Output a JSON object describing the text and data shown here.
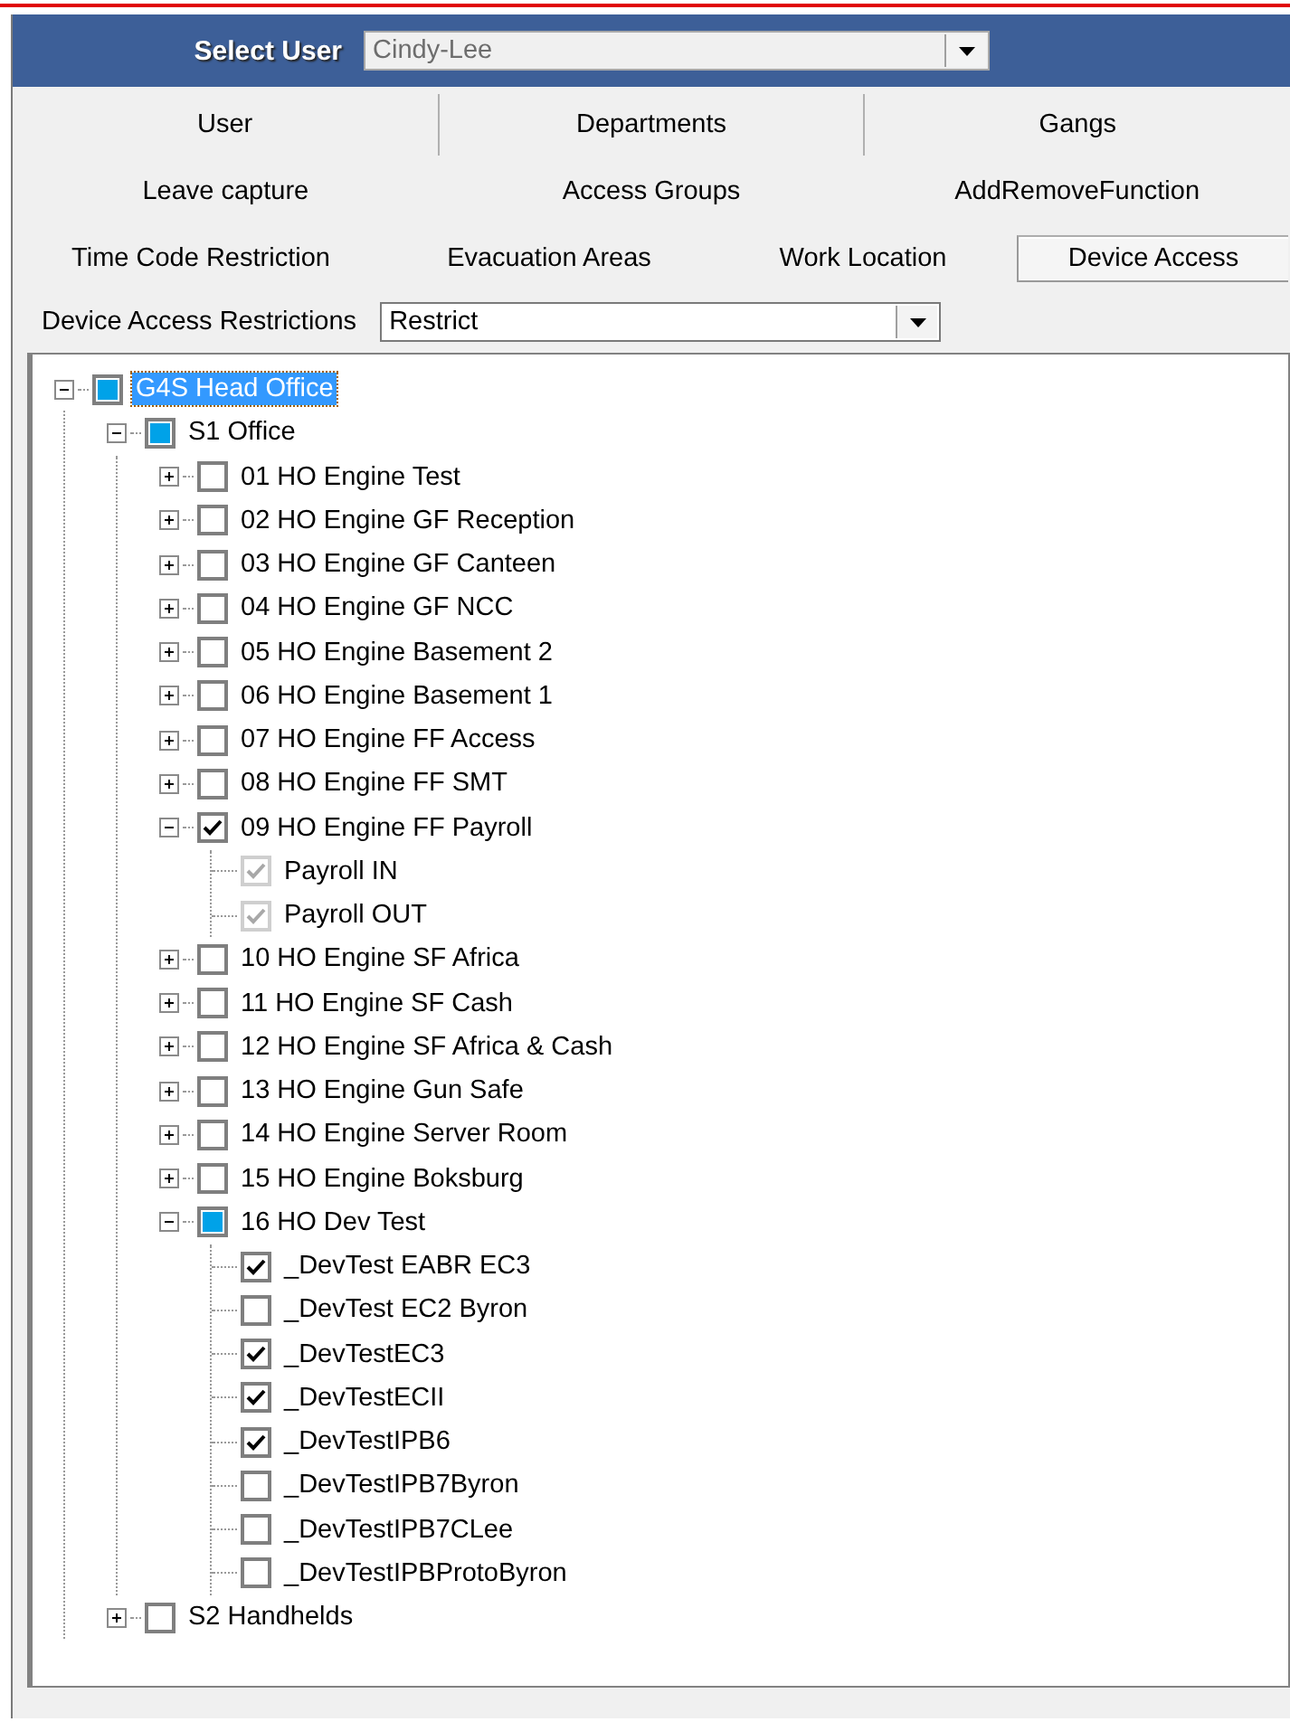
{
  "header": {
    "label": "Select User",
    "user_select": {
      "value": "Cindy-Lee",
      "disabled": true
    }
  },
  "tab_rows": [
    [
      {
        "label": "User",
        "selected": false
      },
      {
        "label": "Departments",
        "selected": false
      },
      {
        "label": "Gangs",
        "selected": false
      }
    ],
    [
      {
        "label": "Leave capture",
        "selected": false
      },
      {
        "label": "Access Groups",
        "selected": false
      },
      {
        "label": "AddRemoveFunction",
        "selected": false
      }
    ],
    [
      {
        "label": "Time Code Restriction",
        "selected": false
      },
      {
        "label": "Evacuation Areas",
        "selected": false
      },
      {
        "label": "Work Location",
        "selected": false
      },
      {
        "label": "Device Access",
        "selected": true
      }
    ]
  ],
  "restriction": {
    "label": "Device Access Restrictions",
    "select": {
      "value": "Restrict",
      "disabled": false
    }
  },
  "tree": [
    {
      "label": "G4S Head Office",
      "kind": "branch",
      "expanded": true,
      "checked": false,
      "partial": true,
      "disabled": false,
      "selected": true,
      "children": [
        {
          "label": "S1 Office",
          "kind": "branch",
          "expanded": true,
          "checked": false,
          "partial": true,
          "disabled": false,
          "selected": false,
          "children": [
            {
              "label": "01 HO Engine Test",
              "kind": "branch",
              "expanded": false,
              "checked": false,
              "partial": false,
              "disabled": false,
              "selected": false
            },
            {
              "label": "02 HO Engine GF Reception",
              "kind": "branch",
              "expanded": false,
              "checked": false,
              "partial": false,
              "disabled": false,
              "selected": false
            },
            {
              "label": "03 HO Engine GF Canteen",
              "kind": "branch",
              "expanded": false,
              "checked": false,
              "partial": false,
              "disabled": false,
              "selected": false
            },
            {
              "label": "04 HO Engine GF NCC",
              "kind": "branch",
              "expanded": false,
              "checked": false,
              "partial": false,
              "disabled": false,
              "selected": false
            },
            {
              "label": "05 HO Engine Basement 2",
              "kind": "branch",
              "expanded": false,
              "checked": false,
              "partial": false,
              "disabled": false,
              "selected": false
            },
            {
              "label": "06 HO Engine Basement 1",
              "kind": "branch",
              "expanded": false,
              "checked": false,
              "partial": false,
              "disabled": false,
              "selected": false
            },
            {
              "label": "07 HO Engine FF Access",
              "kind": "branch",
              "expanded": false,
              "checked": false,
              "partial": false,
              "disabled": false,
              "selected": false
            },
            {
              "label": "08 HO Engine FF SMT",
              "kind": "branch",
              "expanded": false,
              "checked": false,
              "partial": false,
              "disabled": false,
              "selected": false
            },
            {
              "label": "09 HO Engine FF Payroll",
              "kind": "branch",
              "expanded": true,
              "checked": true,
              "partial": false,
              "disabled": false,
              "selected": false,
              "children": [
                {
                  "label": "Payroll IN",
                  "kind": "leaf",
                  "checked": true,
                  "partial": false,
                  "disabled": true,
                  "selected": false
                },
                {
                  "label": "Payroll OUT",
                  "kind": "leaf",
                  "checked": true,
                  "partial": false,
                  "disabled": true,
                  "selected": false
                }
              ]
            },
            {
              "label": "10 HO Engine SF Africa",
              "kind": "branch",
              "expanded": false,
              "checked": false,
              "partial": false,
              "disabled": false,
              "selected": false
            },
            {
              "label": "11 HO Engine SF Cash",
              "kind": "branch",
              "expanded": false,
              "checked": false,
              "partial": false,
              "disabled": false,
              "selected": false
            },
            {
              "label": "12 HO Engine SF Africa & Cash",
              "kind": "branch",
              "expanded": false,
              "checked": false,
              "partial": false,
              "disabled": false,
              "selected": false
            },
            {
              "label": "13 HO Engine Gun Safe",
              "kind": "branch",
              "expanded": false,
              "checked": false,
              "partial": false,
              "disabled": false,
              "selected": false
            },
            {
              "label": "14 HO Engine Server Room",
              "kind": "branch",
              "expanded": false,
              "checked": false,
              "partial": false,
              "disabled": false,
              "selected": false
            },
            {
              "label": "15 HO Engine Boksburg",
              "kind": "branch",
              "expanded": false,
              "checked": false,
              "partial": false,
              "disabled": false,
              "selected": false
            },
            {
              "label": "16 HO Dev Test",
              "kind": "branch",
              "expanded": true,
              "checked": false,
              "partial": true,
              "disabled": false,
              "selected": false,
              "children": [
                {
                  "label": "_DevTest EABR EC3",
                  "kind": "leaf",
                  "checked": true,
                  "partial": false,
                  "disabled": false,
                  "selected": false
                },
                {
                  "label": "_DevTest EC2 Byron",
                  "kind": "leaf",
                  "checked": false,
                  "partial": false,
                  "disabled": false,
                  "selected": false
                },
                {
                  "label": "_DevTestEC3",
                  "kind": "leaf",
                  "checked": true,
                  "partial": false,
                  "disabled": false,
                  "selected": false
                },
                {
                  "label": "_DevTestECII",
                  "kind": "leaf",
                  "checked": true,
                  "partial": false,
                  "disabled": false,
                  "selected": false
                },
                {
                  "label": "_DevTestIPB6",
                  "kind": "leaf",
                  "checked": true,
                  "partial": false,
                  "disabled": false,
                  "selected": false
                },
                {
                  "label": "_DevTestIPB7Byron",
                  "kind": "leaf",
                  "checked": false,
                  "partial": false,
                  "disabled": false,
                  "selected": false
                },
                {
                  "label": "_DevTestIPB7CLee",
                  "kind": "leaf",
                  "checked": false,
                  "partial": false,
                  "disabled": false,
                  "selected": false
                },
                {
                  "label": "_DevTestIPBProtoByron",
                  "kind": "leaf",
                  "checked": false,
                  "partial": false,
                  "disabled": false,
                  "selected": false
                }
              ]
            }
          ]
        },
        {
          "label": "S2 Handhelds",
          "kind": "branch",
          "expanded": false,
          "checked": false,
          "partial": false,
          "disabled": false,
          "selected": false
        }
      ]
    }
  ]
}
